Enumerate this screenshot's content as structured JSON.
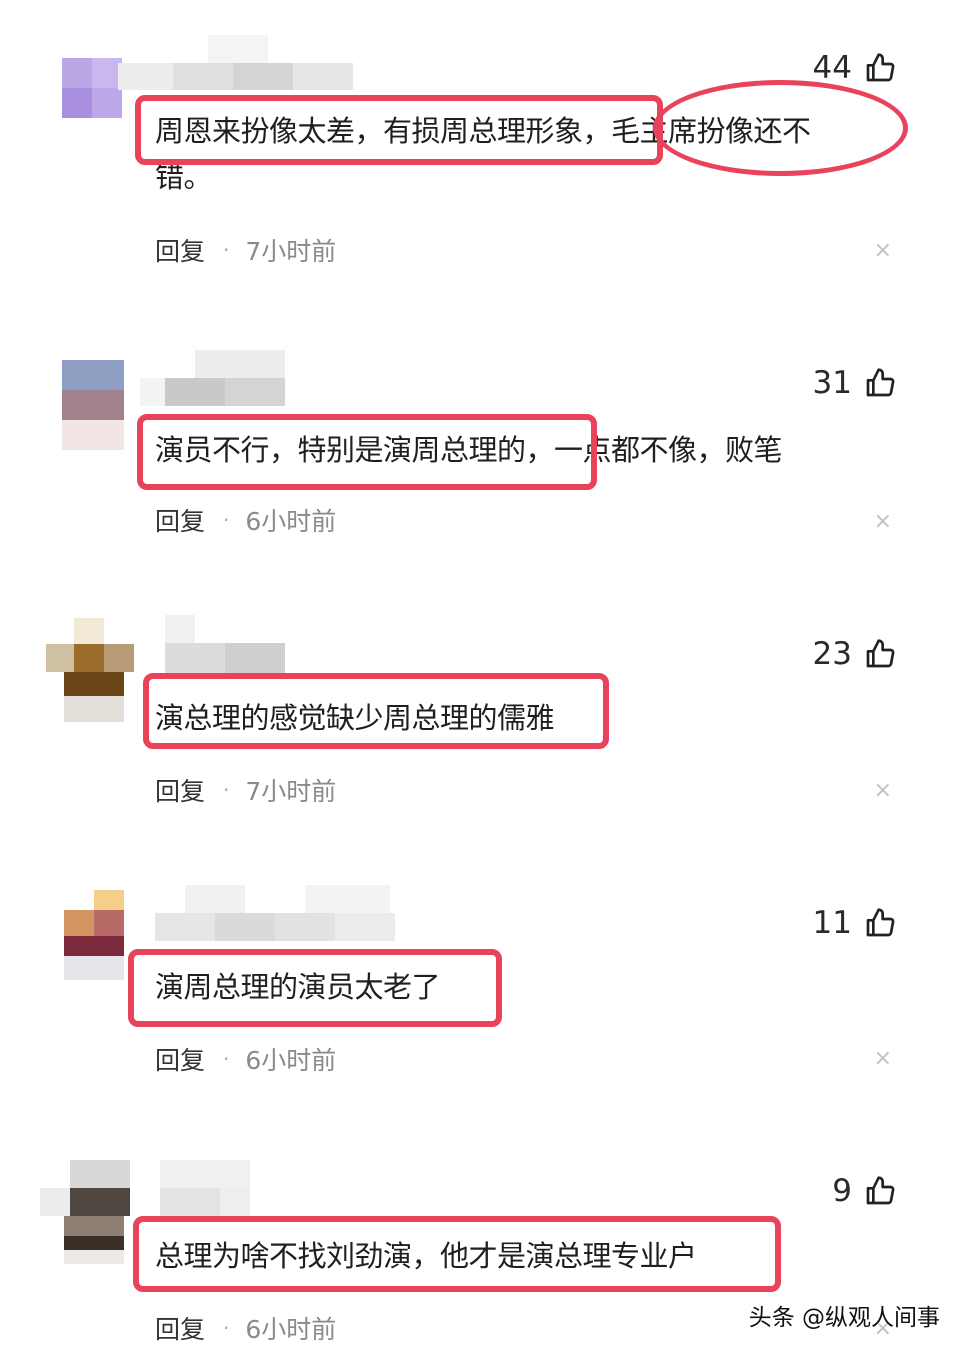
{
  "comments": [
    {
      "text_line1": "周恩来扮像太差，有损周总理形象，毛主席扮像还不",
      "text_line2": "错。",
      "likes": "44",
      "reply_label": "回复",
      "time": "7小时前"
    },
    {
      "text_line1": "演员不行，特别是演周总理的，一点都不像，败笔",
      "likes": "31",
      "reply_label": "回复",
      "time": "6小时前"
    },
    {
      "text_line1": "演总理的感觉缺少周总理的儒雅",
      "likes": "23",
      "reply_label": "回复",
      "time": "7小时前"
    },
    {
      "text_line1": "演周总理的演员太老了",
      "likes": "11",
      "reply_label": "回复",
      "time": "6小时前"
    },
    {
      "text_line1": "总理为啥不找刘劲演，他才是演总理专业户",
      "likes": "9",
      "reply_label": "回复",
      "time": "6小时前"
    }
  ],
  "meta_separator": "·",
  "close_glyph": "×",
  "watermark": "头条 @纵观人间事",
  "icons": {
    "like": "thumbs-up-icon",
    "close": "close-icon"
  },
  "colors": {
    "highlight": "#e8435b",
    "time_text": "#8a8a8a",
    "close": "#c0c0c0"
  }
}
